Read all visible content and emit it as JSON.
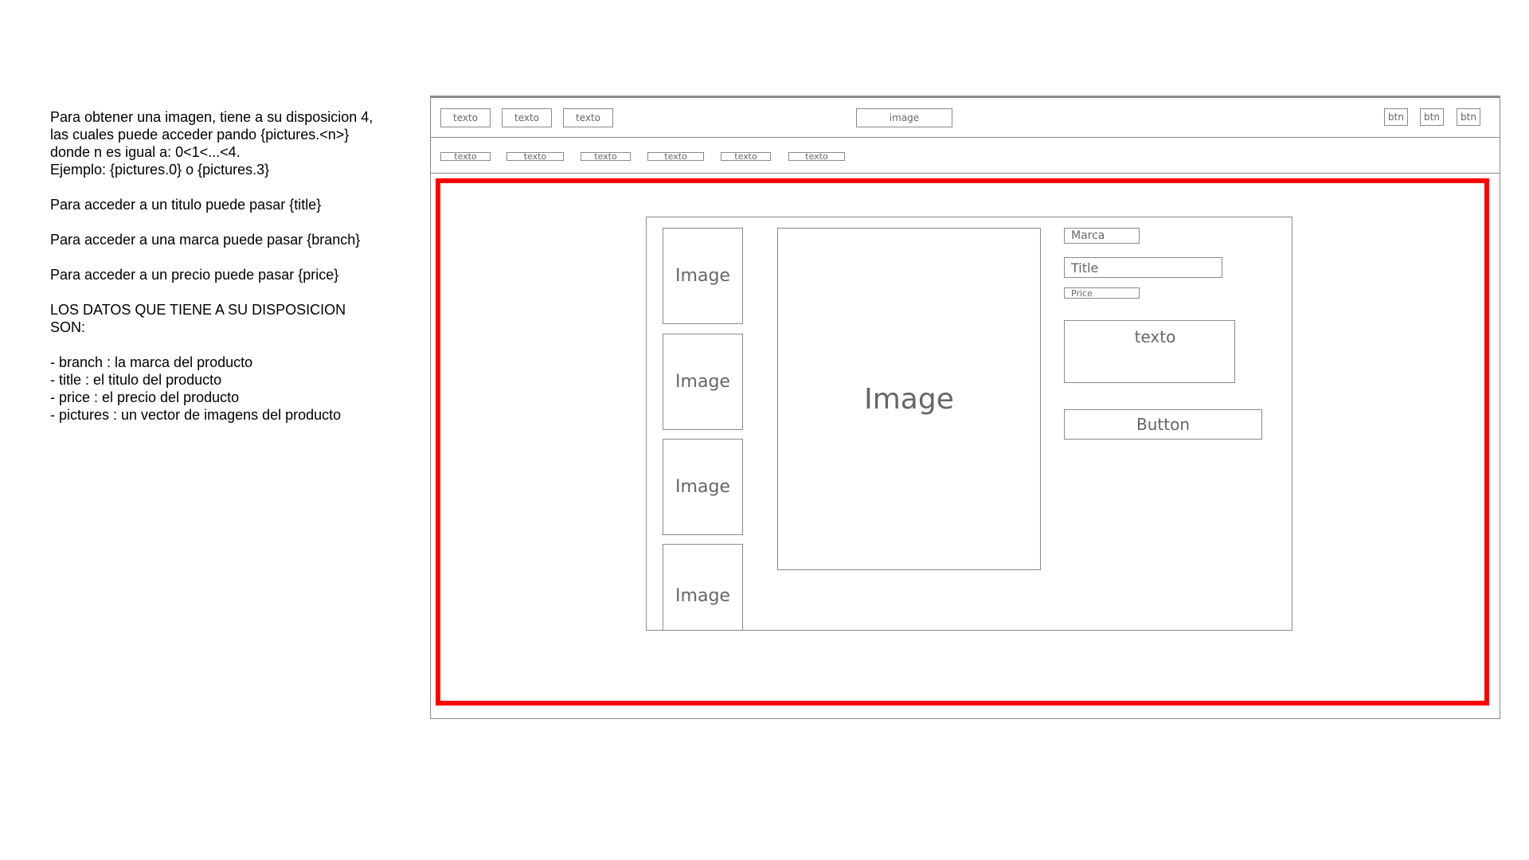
{
  "instructions": {
    "paragraph_1": [
      "Para obtener una imagen, tiene a su disposicion 4,",
      "las cuales puede acceder pando {pictures.<n>}",
      "donde n es igual a: 0<1<...<4.",
      "Ejemplo: {pictures.0} o {pictures.3}"
    ],
    "paragraph_title": "Para acceder a un titulo puede pasar {title}",
    "paragraph_brand": "Para acceder a una marca puede pasar {branch}",
    "paragraph_price": "Para acceder a un precio puede pasar {price}",
    "heading": [
      "LOS DATOS QUE TIENE A SU DISPOSICION",
      "SON:"
    ],
    "list": [
      "- branch : la marca del producto",
      "- title : el titulo del producto",
      "- price : el precio del producto",
      "- pictures : un vector de imagens del producto"
    ]
  },
  "wireframe": {
    "header": {
      "links": [
        "texto",
        "texto",
        "texto"
      ],
      "logo_label": "image",
      "buttons": [
        "btn",
        "btn",
        "btn"
      ]
    },
    "subnav": [
      "texto",
      "texto",
      "texto",
      "texto",
      "texto",
      "texto"
    ],
    "product": {
      "thumbnails": [
        "Image",
        "Image",
        "Image",
        "Image"
      ],
      "main_image": "Image",
      "brand": "Marca",
      "title": "Title",
      "price": "Price",
      "description": "texto",
      "button": "Button"
    },
    "highlight_color": "#ff0000",
    "wire_color": "#8a8a8a"
  }
}
